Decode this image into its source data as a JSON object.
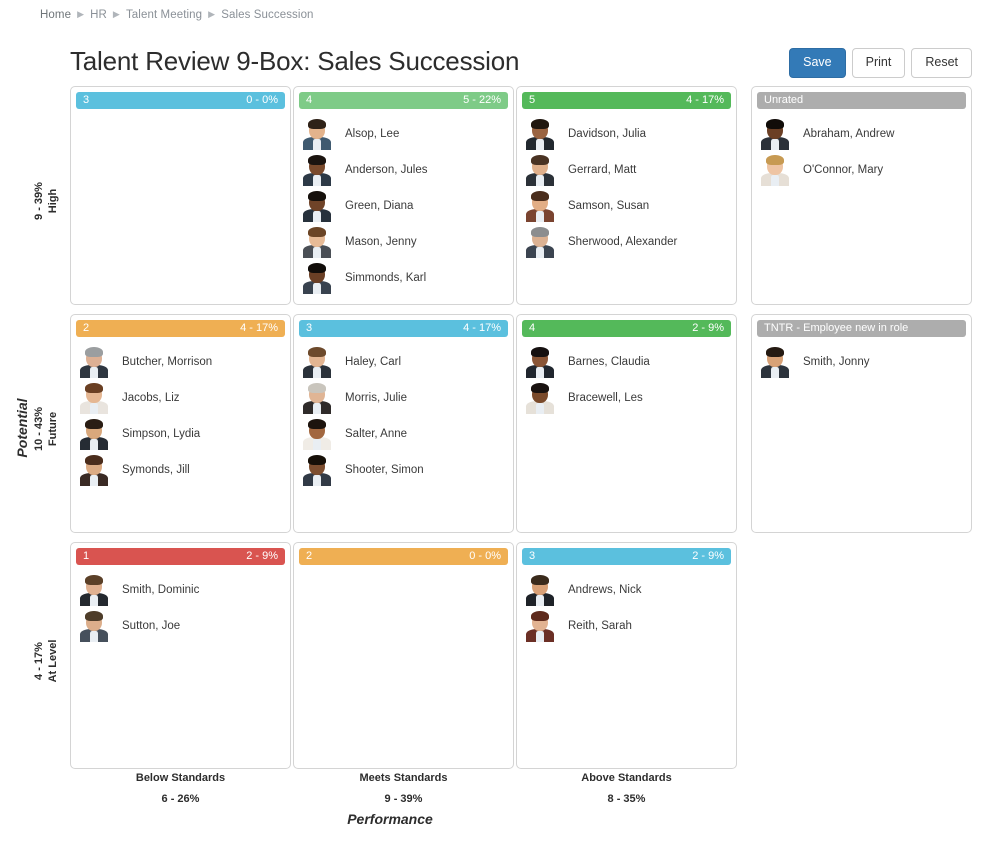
{
  "breadcrumb": {
    "items": [
      "Home",
      "HR",
      "Talent Meeting",
      "Sales Succession"
    ],
    "separator": "▶"
  },
  "header": {
    "title": "Talent Review 9-Box: Sales Succession"
  },
  "toolbar": {
    "save_label": "Save",
    "print_label": "Print",
    "reset_label": "Reset"
  },
  "colors": {
    "green_dark": "#54B95A",
    "green_light": "#7ECB87",
    "blue": "#5BC0DE",
    "orange": "#EFAF53",
    "red": "#D95450",
    "gray": "#ADADAD",
    "primary_button": "#337AB7"
  },
  "axes": {
    "y_title": "Potential",
    "x_title": "Performance",
    "y_levels": [
      {
        "pct": "9 - 39%",
        "name": "High"
      },
      {
        "pct": "10 - 43%",
        "name": "Future"
      },
      {
        "pct": "4 - 17%",
        "name": "At Level"
      }
    ],
    "x_levels": [
      {
        "name": "Below Standards",
        "pct": "6 - 26%"
      },
      {
        "name": "Meets Standards",
        "pct": "9 - 39%"
      },
      {
        "name": "Above Standards",
        "pct": "8 - 35%"
      }
    ]
  },
  "chart_data": {
    "type": "table",
    "title": "Talent Review 9-Box: Sales Succession",
    "xlabel": "Performance",
    "ylabel": "Potential",
    "columns": [
      "Below Standards",
      "Meets Standards",
      "Above Standards"
    ],
    "rows": [
      "High",
      "Future",
      "At Level"
    ],
    "counts": [
      [
        0,
        5,
        4
      ],
      [
        4,
        4,
        2
      ],
      [
        2,
        0,
        2
      ]
    ],
    "percents": [
      [
        "0%",
        "22%",
        "17%"
      ],
      [
        "17%",
        "17%",
        "9%"
      ],
      [
        "9%",
        "0%",
        "9%"
      ]
    ],
    "row_totals": [
      {
        "count": 9,
        "pct": "39%"
      },
      {
        "count": 10,
        "pct": "43%"
      },
      {
        "count": 4,
        "pct": "17%"
      }
    ],
    "column_totals": [
      {
        "count": 6,
        "pct": "26%"
      },
      {
        "count": 9,
        "pct": "39%"
      },
      {
        "count": 8,
        "pct": "35%"
      }
    ]
  },
  "boxes": [
    {
      "rating": "3",
      "count_label": "0 - 0%",
      "color": "#5BC0DE",
      "people": []
    },
    {
      "rating": "4",
      "count_label": "5 - 22%",
      "color": "#7ECB87",
      "people": [
        {
          "name": "Alsop, Lee",
          "skin": "#e3b38c",
          "hair": "#2f2218",
          "jacket": "#3f5a70"
        },
        {
          "name": "Anderson, Jules",
          "skin": "#7a4a2c",
          "hair": "#1b1410",
          "jacket": "#2d3a47"
        },
        {
          "name": "Green, Diana",
          "skin": "#6f4328",
          "hair": "#15100c",
          "jacket": "#27313c"
        },
        {
          "name": "Mason, Jenny",
          "skin": "#e7bb97",
          "hair": "#6b4526",
          "jacket": "#4a4f56"
        },
        {
          "name": "Simmonds, Karl",
          "skin": "#6a3f25",
          "hair": "#110d0a",
          "jacket": "#39434f"
        }
      ]
    },
    {
      "rating": "5",
      "count_label": "4 - 17%",
      "color": "#54B95A",
      "people": [
        {
          "name": "Davidson, Julia",
          "skin": "#9a6442",
          "hair": "#20170f",
          "jacket": "#22282f"
        },
        {
          "name": "Gerrard, Matt",
          "skin": "#e0b08b",
          "hair": "#4a3323",
          "jacket": "#2b3138"
        },
        {
          "name": "Samson, Susan",
          "skin": "#e2ae86",
          "hair": "#4a2d1c",
          "jacket": "#7a4430"
        },
        {
          "name": "Sherwood, Alexander",
          "skin": "#dcb293",
          "hair": "#8b8d8f",
          "jacket": "#3b4450"
        }
      ]
    },
    {
      "rating": "2",
      "count_label": "4 - 17%",
      "color": "#EFAF53",
      "people": [
        {
          "name": "Butcher, Morrison",
          "skin": "#ddb094",
          "hair": "#9b9ea0",
          "jacket": "#2e3640"
        },
        {
          "name": "Jacobs, Liz",
          "skin": "#e5b793",
          "hair": "#6a3f23",
          "jacket": "#e9e4de"
        },
        {
          "name": "Simpson, Lydia",
          "skin": "#d9a87c",
          "hair": "#2a1d14",
          "jacket": "#262c34"
        },
        {
          "name": "Symonds, Jill",
          "skin": "#dcab83",
          "hair": "#4b2d1c",
          "jacket": "#3a2a24"
        }
      ]
    },
    {
      "rating": "3",
      "count_label": "4 - 17%",
      "color": "#5BC0DE",
      "people": [
        {
          "name": "Haley, Carl",
          "skin": "#e3b592",
          "hair": "#6d4a2c",
          "jacket": "#2b323b"
        },
        {
          "name": "Morris, Julie",
          "skin": "#e0b595",
          "hair": "#c9c5bd",
          "jacket": "#2f2b2a"
        },
        {
          "name": "Salter, Anne",
          "skin": "#a2673f",
          "hair": "#1d140e",
          "jacket": "#f0ece6"
        },
        {
          "name": "Shooter, Simon",
          "skin": "#7d4e2f",
          "hair": "#171008",
          "jacket": "#313a46"
        }
      ]
    },
    {
      "rating": "4",
      "count_label": "2 - 9%",
      "color": "#54B95A",
      "people": [
        {
          "name": "Barnes, Claudia",
          "skin": "#8a5536",
          "hair": "#151010",
          "jacket": "#20262e"
        },
        {
          "name": "Bracewell, Les",
          "skin": "#7a4a2b",
          "hair": "#191210",
          "jacket": "#e6e1d9"
        }
      ]
    },
    {
      "rating": "1",
      "count_label": "2 - 9%",
      "color": "#D95450",
      "people": [
        {
          "name": "Smith, Dominic",
          "skin": "#e0b191",
          "hair": "#5b4028",
          "jacket": "#24292f"
        },
        {
          "name": "Sutton, Joe",
          "skin": "#dcae8b",
          "hair": "#4e3d2a",
          "jacket": "#46505c"
        }
      ]
    },
    {
      "rating": "2",
      "count_label": "0 - 0%",
      "color": "#EFAF53",
      "people": []
    },
    {
      "rating": "3",
      "count_label": "2 - 9%",
      "color": "#5BC0DE",
      "people": [
        {
          "name": "Andrews, Nick",
          "skin": "#d8a076",
          "hair": "#3a2a1c",
          "jacket": "#1e2228"
        },
        {
          "name": "Reith, Sarah",
          "skin": "#e2b392",
          "hair": "#5e2a1c",
          "jacket": "#6b2f25"
        }
      ]
    }
  ],
  "side_panels": [
    {
      "title": "Unrated",
      "people": [
        {
          "name": "Abraham, Andrew",
          "skin": "#6b3f25",
          "hair": "#110c09",
          "jacket": "#2b3038"
        },
        {
          "name": "O'Connor, Mary",
          "skin": "#eec4a3",
          "hair": "#c79a52",
          "jacket": "#e6dfd6"
        }
      ]
    },
    {
      "title": "TNTR - Employee new in role",
      "people": [
        {
          "name": "Smith, Jonny",
          "skin": "#d8a277",
          "hair": "#251a12",
          "jacket": "#2d343d"
        }
      ]
    }
  ]
}
